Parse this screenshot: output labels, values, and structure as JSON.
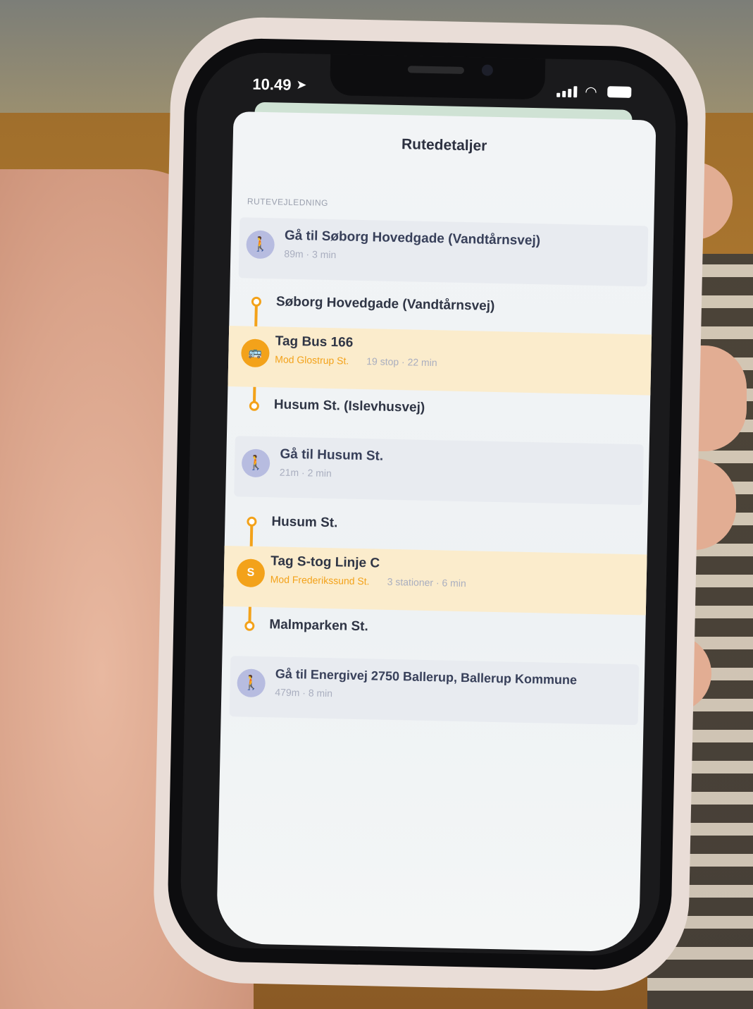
{
  "status_bar": {
    "time": "10.49"
  },
  "header": {
    "title": "Rutedetaljer"
  },
  "section": {
    "label": "RUTEVEJLEDNING"
  },
  "steps": {
    "walk1": {
      "title": "Gå til Søborg Hovedgade (Vandtårnsvej)",
      "sub": "89m · 3 min"
    },
    "bus": {
      "from": "Søborg Hovedgade (Vandtårnsvej)",
      "title": "Tag Bus 166",
      "direction": "Mod Glostrup St.",
      "stats": "19 stop · 22 min",
      "to": "Husum St. (Islevhusvej)"
    },
    "walk2": {
      "title": "Gå til Husum St.",
      "sub": "21m · 2 min"
    },
    "train": {
      "from": "Husum St.",
      "title": "Tag S-tog Linje C",
      "direction": "Mod Frederikssund St.",
      "stats": "3 stationer · 6 min",
      "to": "Malmparken St.",
      "icon_letter": "S"
    },
    "walk3": {
      "title": "Gå til Energivej 2750 Ballerup, Ballerup Kommune",
      "sub": "479m · 8 min"
    }
  },
  "colors": {
    "accent": "#f3a21a",
    "walk_icon": "#b7bce0"
  }
}
